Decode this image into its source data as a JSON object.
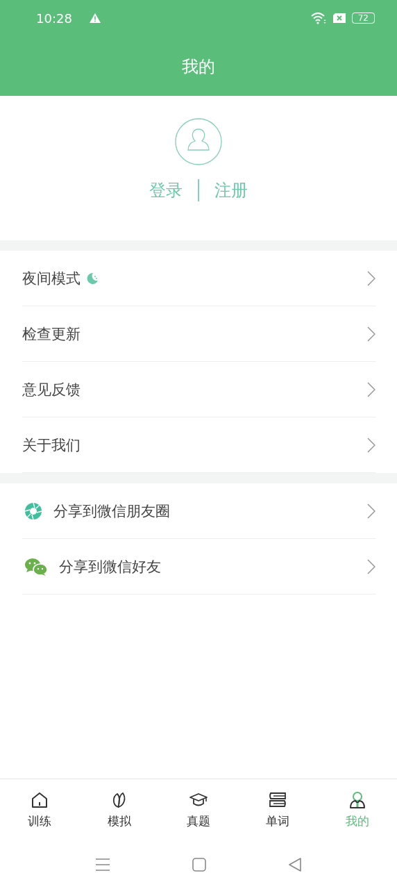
{
  "status_bar": {
    "time": "10:28",
    "battery": "72"
  },
  "header": {
    "title": "我的"
  },
  "profile": {
    "login": "登录",
    "register": "注册"
  },
  "menu_groups": [
    {
      "items": [
        {
          "label": "夜间模式",
          "kind": "night"
        },
        {
          "label": "检查更新",
          "kind": "plain"
        },
        {
          "label": "意见反馈",
          "kind": "plain"
        },
        {
          "label": "关于我们",
          "kind": "plain"
        }
      ]
    },
    {
      "items": [
        {
          "label": "分享到微信朋友圈",
          "kind": "moments"
        },
        {
          "label": "分享到微信好友",
          "kind": "wechat"
        }
      ]
    }
  ],
  "tabs": [
    {
      "label": "训练",
      "kind": "home",
      "selected": false
    },
    {
      "label": "模拟",
      "kind": "leaf",
      "selected": false
    },
    {
      "label": "真题",
      "kind": "cap",
      "selected": false
    },
    {
      "label": "单词",
      "kind": "books",
      "selected": false
    },
    {
      "label": "我的",
      "kind": "person",
      "selected": true
    }
  ]
}
